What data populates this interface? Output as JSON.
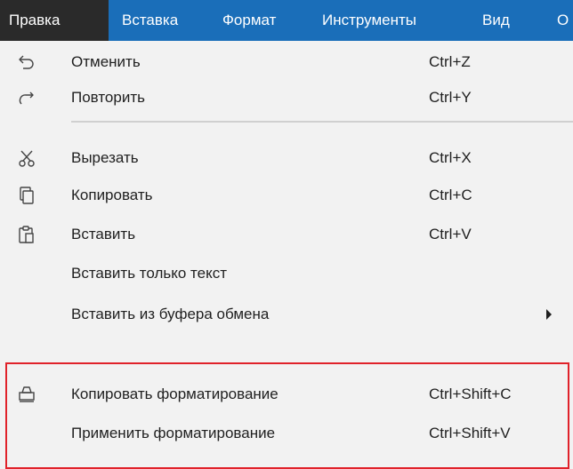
{
  "colors": {
    "menubar_bg": "#1a6eb9",
    "active_menu_bg": "#2a2a2a",
    "menu_bg": "#f2f2f2",
    "highlight_border": "#e0222a"
  },
  "menubar": {
    "items": [
      {
        "label": "Правка",
        "active": true
      },
      {
        "label": "Вставка"
      },
      {
        "label": "Формат"
      },
      {
        "label": "Инструменты"
      },
      {
        "label": "Вид"
      },
      {
        "label": "О"
      }
    ]
  },
  "menu": {
    "items": [
      {
        "label": "Отменить",
        "shortcut": "Ctrl+Z",
        "icon": "undo-icon"
      },
      {
        "label": "Повторить",
        "shortcut": "Ctrl+Y",
        "icon": "redo-icon"
      },
      {
        "label": "Вырезать",
        "shortcut": "Ctrl+X",
        "icon": "scissors-icon"
      },
      {
        "label": "Копировать",
        "shortcut": "Ctrl+C",
        "icon": "copy-icon"
      },
      {
        "label": "Вставить",
        "shortcut": "Ctrl+V",
        "icon": "paste-icon"
      },
      {
        "label": "Вставить только текст",
        "shortcut": ""
      },
      {
        "label": "Вставить из буфера обмена",
        "shortcut": "",
        "has_submenu": true
      },
      {
        "label": "Копировать форматирование",
        "shortcut": "Ctrl+Shift+C",
        "icon": "format-painter-icon"
      },
      {
        "label": "Применить форматирование",
        "shortcut": "Ctrl+Shift+V"
      }
    ]
  }
}
